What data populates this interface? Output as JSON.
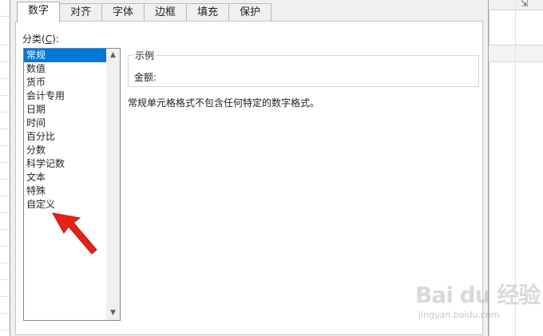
{
  "tabs": [
    {
      "label": "数字",
      "active": true
    },
    {
      "label": "对齐",
      "active": false
    },
    {
      "label": "字体",
      "active": false
    },
    {
      "label": "边框",
      "active": false
    },
    {
      "label": "填充",
      "active": false
    },
    {
      "label": "保护",
      "active": false
    }
  ],
  "category": {
    "label_prefix": "分类(",
    "label_key": "C",
    "label_suffix": "):",
    "selected": "常规",
    "items": [
      "常规",
      "数值",
      "货币",
      "会计专用",
      "日期",
      "时间",
      "百分比",
      "分数",
      "科学记数",
      "文本",
      "特殊",
      "自定义"
    ]
  },
  "sample": {
    "title": "示例",
    "value_label": "金额:"
  },
  "description": "常规单元格格式不包含任何特定的数字格式。",
  "annotation": {
    "color": "#e8201a",
    "points_to": "自定义"
  },
  "colors": {
    "selection": "#0078d7",
    "dialog_bg": "#f0f0f0"
  },
  "watermark": {
    "brand": "Bai du 经验",
    "url": "jingyan.baidu.com"
  },
  "icons": {
    "resize": "resize-icon",
    "scroll_up": "chevron-up-icon",
    "scroll_down": "chevron-down-icon"
  }
}
